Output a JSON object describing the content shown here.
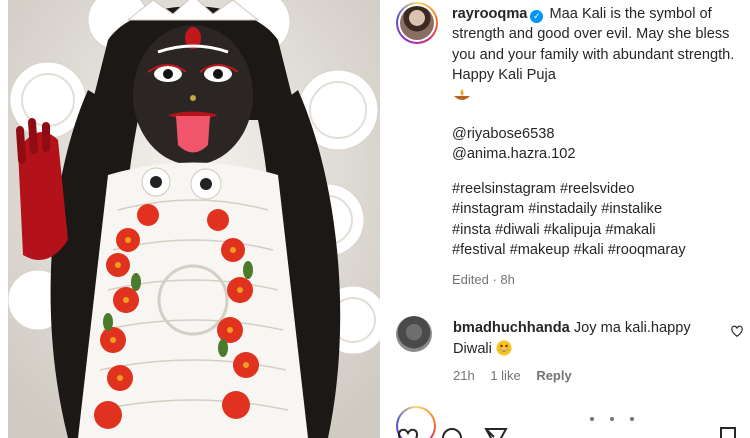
{
  "post": {
    "username": "rayrooqma",
    "caption_line": "Maa Kali is the symbol of strength and good over evil. May she bless you and your family with abundant strength. Happy Kali Puja",
    "mentions": [
      "@riyabose6538",
      "@anima.hazra.102"
    ],
    "hashtags": [
      "#reelsinstagram #reelsvideo",
      "#instagram #instadaily #instalike",
      "#insta #diwali #kalipuja #makali",
      "#festival #makeup #kali #rooqmaray"
    ],
    "edited": "Edited · 8h"
  },
  "comment": {
    "username": "bmadhuchhanda",
    "text": "Joy ma kali.happy Diwali",
    "time": "21h",
    "likes": "1 like",
    "reply": "Reply"
  },
  "icons": {
    "verified": "verified-badge-icon",
    "diya": "diya-lamp-emoji",
    "grin": "grinning-emoji",
    "heart": "heart-outline-icon"
  },
  "colors": {
    "verified_blue": "#0095f6",
    "meta_gray": "#737373"
  }
}
